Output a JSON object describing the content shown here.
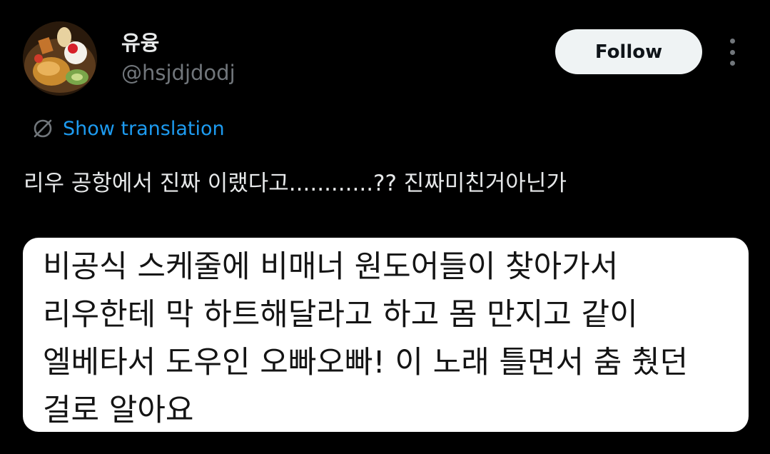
{
  "author": {
    "display_name": "유융",
    "handle": "@hsjdjdodj",
    "avatar_icon": "dessert-photo-avatar"
  },
  "actions": {
    "follow_label": "Follow",
    "more_icon": "more-vertical-icon"
  },
  "translation": {
    "icon": "globe-icon",
    "label": "Show translation"
  },
  "tweet": {
    "text": "리우 공항에서 진짜 이랬다고............?? 진짜미친거아닌가"
  },
  "media": {
    "lines": [
      "비공식 스케줄에 비매너 원도어들이 찾아가서",
      "리우한테 막 하트해달라고 하고 몸 만지고 같이",
      "엘베타서 도우인 오빠오빠! 이 노래 틀면서 춤 췄던",
      "걸로 알아요"
    ]
  },
  "colors": {
    "background": "#000000",
    "text_primary": "#e7e9ea",
    "text_secondary": "#71767b",
    "link": "#1d9bf0",
    "follow_bg": "#eff3f4"
  }
}
